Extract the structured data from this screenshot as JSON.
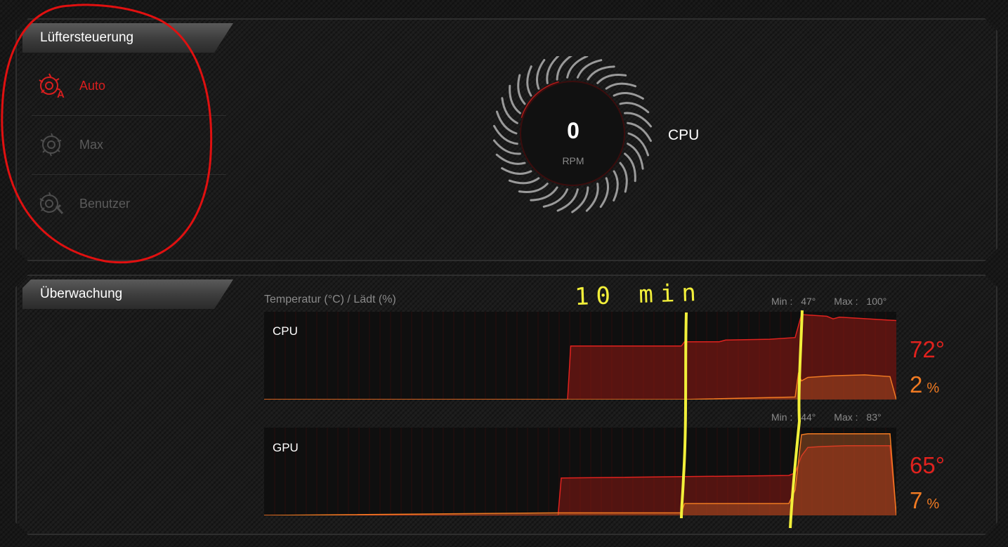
{
  "fan_control": {
    "tab_title": "Lüftersteuerung",
    "modes": [
      {
        "label": "Auto",
        "icon": "fan-auto-icon",
        "active": true
      },
      {
        "label": "Max",
        "icon": "fan-max-icon",
        "active": false
      },
      {
        "label": "Benutzer",
        "icon": "fan-user-icon",
        "active": false
      }
    ],
    "fan": {
      "rpm": "0",
      "unit": "RPM",
      "label": "CPU"
    }
  },
  "monitoring": {
    "tab_title": "Überwachung",
    "chart_title": "Temperatur (°C) / Lädt (%)",
    "min_label": "Min :",
    "max_label": "Max :",
    "cpu": {
      "label": "CPU",
      "min": "47°",
      "max": "100°",
      "temp": "72°",
      "load": "2",
      "load_unit": "%"
    },
    "gpu": {
      "label": "GPU",
      "min": "44°",
      "max": "83°",
      "temp": "65°",
      "load": "7",
      "load_unit": "%"
    }
  },
  "colors": {
    "accent_red": "#d81e1e",
    "load_orange": "#f07a22",
    "annotation_yellow": "#f2ef3a",
    "annotation_red": "#e01010"
  },
  "annotation": {
    "text": "10 min"
  },
  "chart_data": [
    {
      "type": "area",
      "series": [
        {
          "name": "CPU",
          "x": [
            0,
            48,
            48.5,
            66,
            66.5,
            72,
            73,
            80,
            84,
            85,
            89,
            90,
            91,
            100
          ],
          "values": [
            0,
            0,
            63,
            63,
            68,
            68,
            70,
            71,
            73,
            100,
            98,
            95,
            97,
            93
          ]
        },
        {
          "name": "2 %",
          "x": [
            0,
            48,
            66,
            84,
            84.5,
            85,
            86,
            90,
            95,
            99,
            100
          ],
          "values": [
            0,
            0,
            0,
            3,
            30,
            22,
            26,
            28,
            29,
            27,
            0
          ]
        }
      ],
      "xlim": [
        0,
        100
      ],
      "ylim": [
        0,
        100
      ],
      "grid": true
    },
    {
      "type": "area",
      "series": [
        {
          "name": "GPU",
          "x": [
            0,
            46.5,
            47,
            83,
            84,
            85,
            86,
            88,
            92,
            99,
            100
          ],
          "values": [
            0,
            0,
            44,
            47,
            50,
            70,
            80,
            81,
            82,
            82,
            0
          ]
        },
        {
          "name": "7 %",
          "x": [
            0,
            46.5,
            66,
            66.5,
            83,
            84,
            85,
            86,
            99,
            100
          ],
          "values": [
            0,
            3,
            3,
            14,
            14,
            30,
            95,
            96,
            96,
            0
          ]
        }
      ],
      "xlim": [
        0,
        100
      ],
      "ylim": [
        0,
        100
      ],
      "grid": true
    }
  ]
}
